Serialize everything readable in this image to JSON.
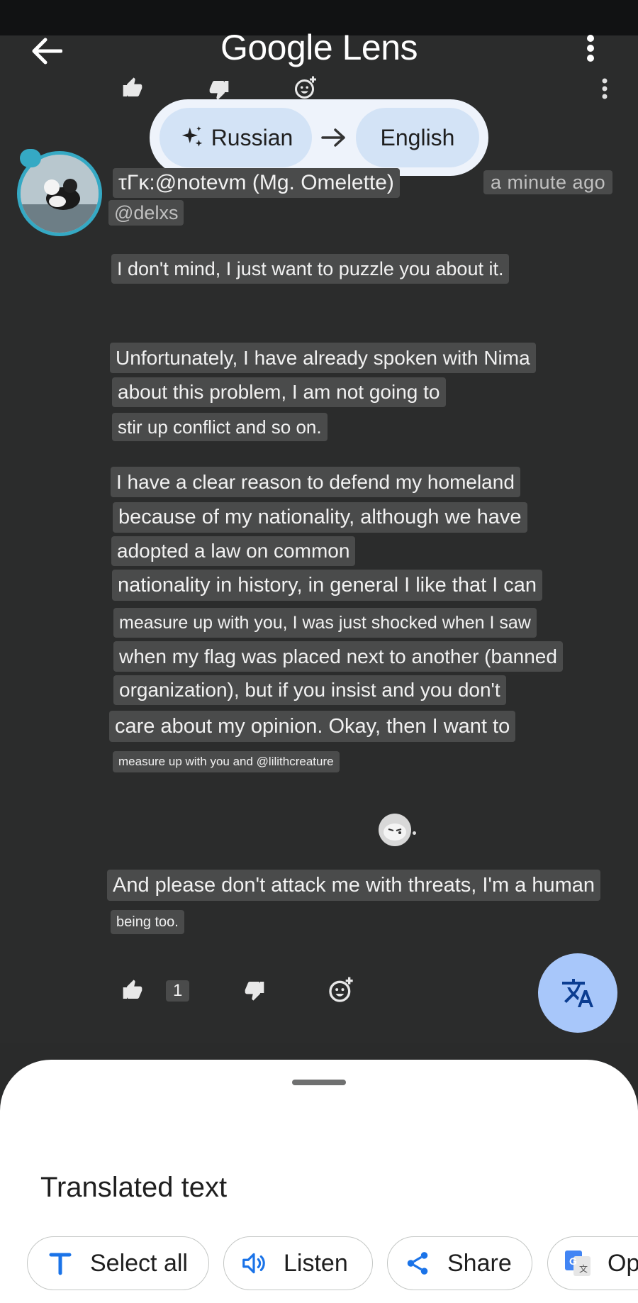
{
  "app": {
    "title": "Google Lens"
  },
  "lang": {
    "source": "Russian",
    "target": "English"
  },
  "post": {
    "author": "τΓκ:@notevm (Mg. Omelette)",
    "handle": "@delxs",
    "time": "a minute ago",
    "lines": [
      "I don't mind, I just want to puzzle you about it.",
      "Unfortunately, I have already spoken with Nima",
      "about this problem, I am not going to",
      "stir up conflict and so on.",
      "I have a clear reason to defend my homeland",
      "because of my nationality, although we have",
      "adopted a law on common",
      "nationality in history, in general I like that I can",
      "measure up with you, I was just shocked when I saw",
      "when my flag was placed next to another (banned",
      "organization), but if you insist and you don't",
      "care about my opinion. Okay, then I want to",
      "measure up with you and @lilithcreature",
      "And please don't attack me with threats, I'm a human",
      "being too."
    ],
    "like_count": "1"
  },
  "sheet": {
    "title": "Translated text",
    "actions": [
      "Select all",
      "Listen",
      "Share",
      "Op"
    ]
  },
  "colors": {
    "accent": "#a8c7fa",
    "pill": "#d3e3f6",
    "chip": "#4a4b4b"
  }
}
